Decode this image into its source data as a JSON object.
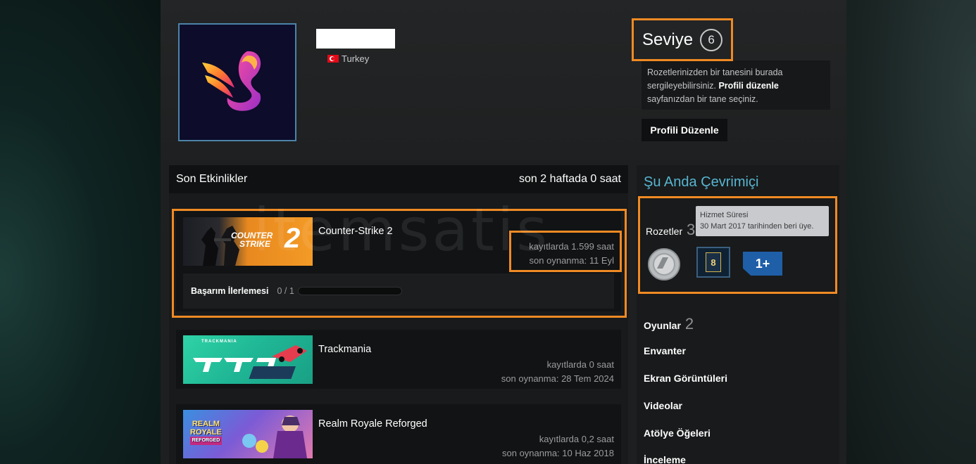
{
  "profile": {
    "location": "Turkey",
    "level_label": "Seviye",
    "level": "6",
    "badge_hint_text_1": "Rozetlerinizden bir tanesini burada sergileyebilirsiniz.",
    "badge_hint_bold": "Profili düzenle",
    "badge_hint_text_2": "sayfanızdan bir tane seçiniz.",
    "edit_profile_button": "Profili Düzenle"
  },
  "recent_activity": {
    "title": "Son Etkinlikler",
    "summary": "son 2 haftada 0 saat",
    "games": [
      {
        "name": "Counter-Strike 2",
        "hours": "kayıtlarda 1.599 saat",
        "last_played": "son oynanma: 11 Eyl",
        "capsule_text_1": "COUNTER",
        "capsule_text_2": "STRIKE",
        "capsule_num": "2",
        "achievement_label": "Başarım İlerlemesi",
        "achievement_count": "0 / 1",
        "achievement_progress": 0
      },
      {
        "name": "Trackmania",
        "hours": "kayıtlarda 0 saat",
        "last_played": "son oynanma: 28 Tem 2024",
        "capsule_text": "TRACKMANIA"
      },
      {
        "name": "Realm Royale Reforged",
        "hours": "kayıtlarda 0,2 saat",
        "last_played": "son oynanma: 10 Haz 2018",
        "capsule_text_1": "REALM",
        "capsule_text_2": "ROYALE",
        "capsule_text_3": "REFORGED"
      }
    ]
  },
  "sidebar": {
    "online_status": "Şu Anda Çevrimiçi",
    "badges_label": "Rozetler",
    "badges_count": "3",
    "tooltip_title": "Hizmet Süresi",
    "tooltip_text": "30 Mart 2017 tarihinden beri üye.",
    "badge_2_value": "8",
    "badge_3_value": "1+",
    "games_label": "Oyunlar",
    "games_count": "2",
    "links": [
      "Envanter",
      "Ekran Görüntüleri",
      "Videolar",
      "Atölye Öğeleri",
      "İnceleme"
    ]
  },
  "watermark": "itemsatis",
  "colors": {
    "highlight": "#f08a24",
    "online": "#58b5d1",
    "panel": "#1d1f20"
  }
}
